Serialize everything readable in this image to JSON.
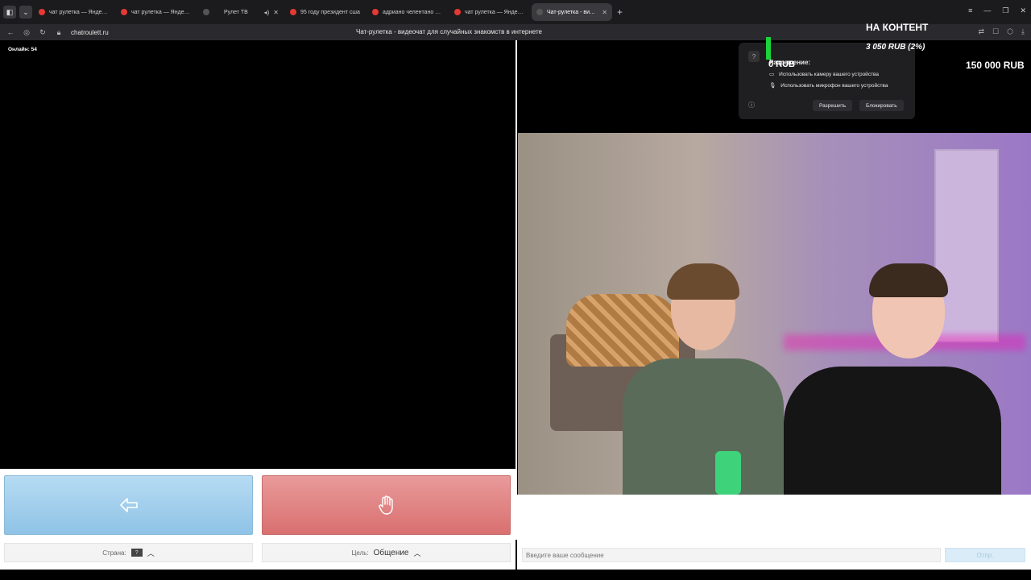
{
  "browser": {
    "tabs": [
      {
        "label": "чат рулетка — Яндекс: на",
        "active": false
      },
      {
        "label": "чат рулетка — Яндекс: на",
        "active": false
      },
      {
        "label": "",
        "active": false
      },
      {
        "label": "Рулет ТВ",
        "active": false
      },
      {
        "label": "95 году президент сша",
        "active": false
      },
      {
        "label": "адриано челентано — Ян",
        "active": false
      },
      {
        "label": "чат рулетка — Яндекс: на",
        "active": false
      },
      {
        "label": "Чат-рулетка - видеочат",
        "active": true
      }
    ],
    "url": "chatroulett.ru",
    "page_title": "Чат-рулетка - видеочат для случайных знакомств в интернете"
  },
  "video": {
    "online_label": "Онлайн: 54"
  },
  "permission_popup": {
    "title": "Разрешение:",
    "camera_text": "Использовать камеру вашего устройства",
    "mic_text": "Использовать микрофон вашего устройства",
    "allow_label": "Разрешить",
    "block_label": "Блокировать"
  },
  "donation_overlay": {
    "title": "НА КОНТЕНТ",
    "progress": "3 050 RUB (2%)",
    "start": "0 RUB",
    "goal": "150 000 RUB",
    "bar_color": "#1bd43a"
  },
  "controls": {
    "next_icon": "arrow-left-icon",
    "stop_icon": "hand-icon",
    "country_label": "Страна:",
    "country_flag": "?",
    "goal_label": "Цель:",
    "goal_value": "Общение"
  },
  "chat": {
    "placeholder": "Введите ваше сообщение",
    "send_label": "Отпр."
  }
}
